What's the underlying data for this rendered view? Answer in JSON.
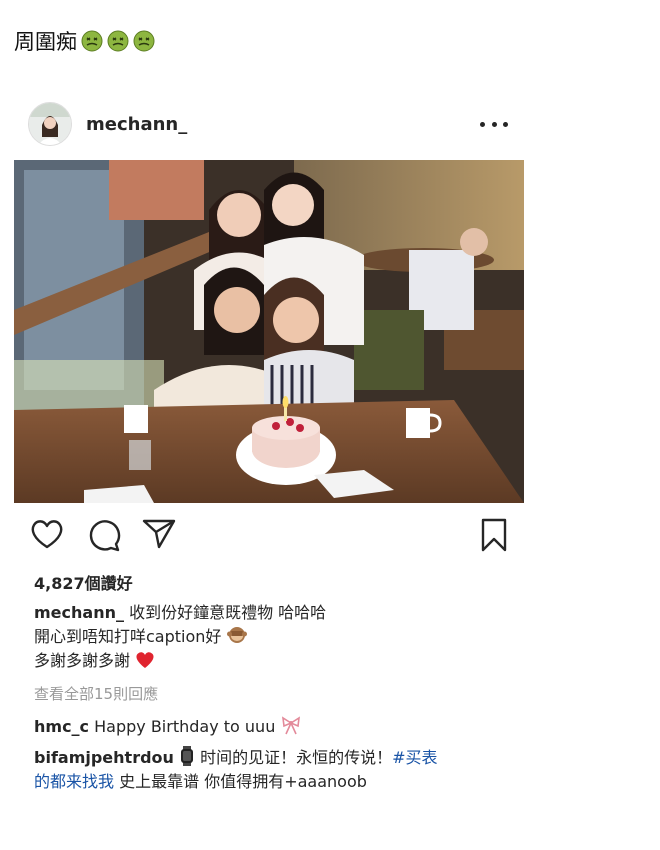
{
  "header_text": "周圍痴",
  "post": {
    "username": "mechann_",
    "likes": "4,827個讚好",
    "caption": {
      "username": "mechann_",
      "line1": "收到份好鐘意既禮物 哈哈哈",
      "line2": "開心到唔知打咩caption好",
      "line3": "多謝多謝多謝"
    },
    "view_all_comments": "查看全部15則回應",
    "comments": [
      {
        "username": "hmc_c",
        "text": "Happy Birthday to uuu"
      },
      {
        "username": "bifamjpehtrdou",
        "text_before": "时间的见证！永恒的传说！",
        "hashtag_part1": "#买表",
        "hashtag_part2": "的都来找我",
        "text_after": " 史上最靠谱 你值得拥有+aaanoob"
      }
    ]
  },
  "colors": {
    "link": "#1a54a6",
    "muted": "#999999",
    "text": "#262626"
  },
  "icons": [
    "nauseated-face-icon",
    "more-options-icon",
    "heart-icon",
    "comment-icon",
    "share-icon",
    "bookmark-icon",
    "see-no-evil-monkey-icon",
    "red-heart-icon",
    "ribbon-icon",
    "watch-icon"
  ]
}
